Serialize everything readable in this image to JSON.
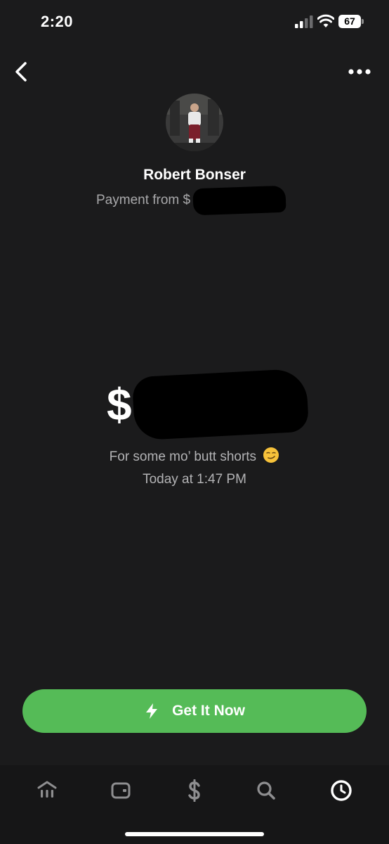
{
  "status_bar": {
    "time": "2:20",
    "battery_level": "67"
  },
  "nav": {
    "back_icon": "chevron-left-icon",
    "more_icon": "ellipsis-icon"
  },
  "profile": {
    "name": "Robert Bonser",
    "subtitle": "Payment from $"
  },
  "payment": {
    "currency_symbol": "$",
    "note": "For some mo’ butt shorts",
    "note_emoji": "smirking-face",
    "timestamp": "Today at 1:47 PM"
  },
  "cta": {
    "label": "Get It Now",
    "icon": "lightning-bolt-icon",
    "color": "#55bb57"
  },
  "tab_bar": {
    "tabs": [
      {
        "icon": "bank-icon",
        "active": false
      },
      {
        "icon": "card-icon",
        "active": false
      },
      {
        "icon": "dollar-icon",
        "active": false
      },
      {
        "icon": "search-icon",
        "active": false
      },
      {
        "icon": "clock-icon",
        "active": true
      }
    ]
  },
  "colors": {
    "background": "#1b1b1c",
    "text_primary": "#ffffff",
    "text_secondary": "#a9a9ab",
    "tab_inactive": "#8e8e90"
  }
}
